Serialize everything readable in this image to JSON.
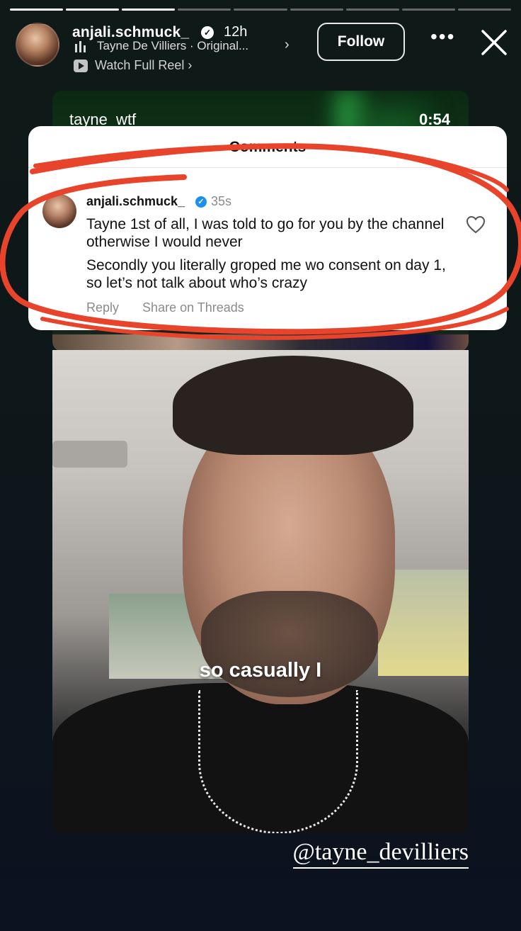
{
  "progress": {
    "segments": 9,
    "completed": 3
  },
  "header": {
    "username": "anjali.schmuck_",
    "time": "12h",
    "audio": "Tayne De Villiers · Original...",
    "reel_link": "Watch Full Reel",
    "follow_label": "Follow",
    "more_label": "•••"
  },
  "reel": {
    "user": "tayne_wtf",
    "duration": "0:54"
  },
  "comments": {
    "title": "Comments",
    "username": "anjali.schmuck_",
    "time": "35s",
    "text_1": "Tayne 1st of all, I was told to go for you by the channel otherwise I would never",
    "text_2": "Secondly you literally groped me wo consent on day 1, so let’s not talk about who’s crazy",
    "reply_label": "Reply",
    "threads_label": "Share on Threads"
  },
  "video": {
    "caption": "so casually I"
  },
  "mention": "@tayne_devilliers",
  "colors": {
    "annotation": "#e8432b",
    "verified": "#1d8ff0"
  }
}
